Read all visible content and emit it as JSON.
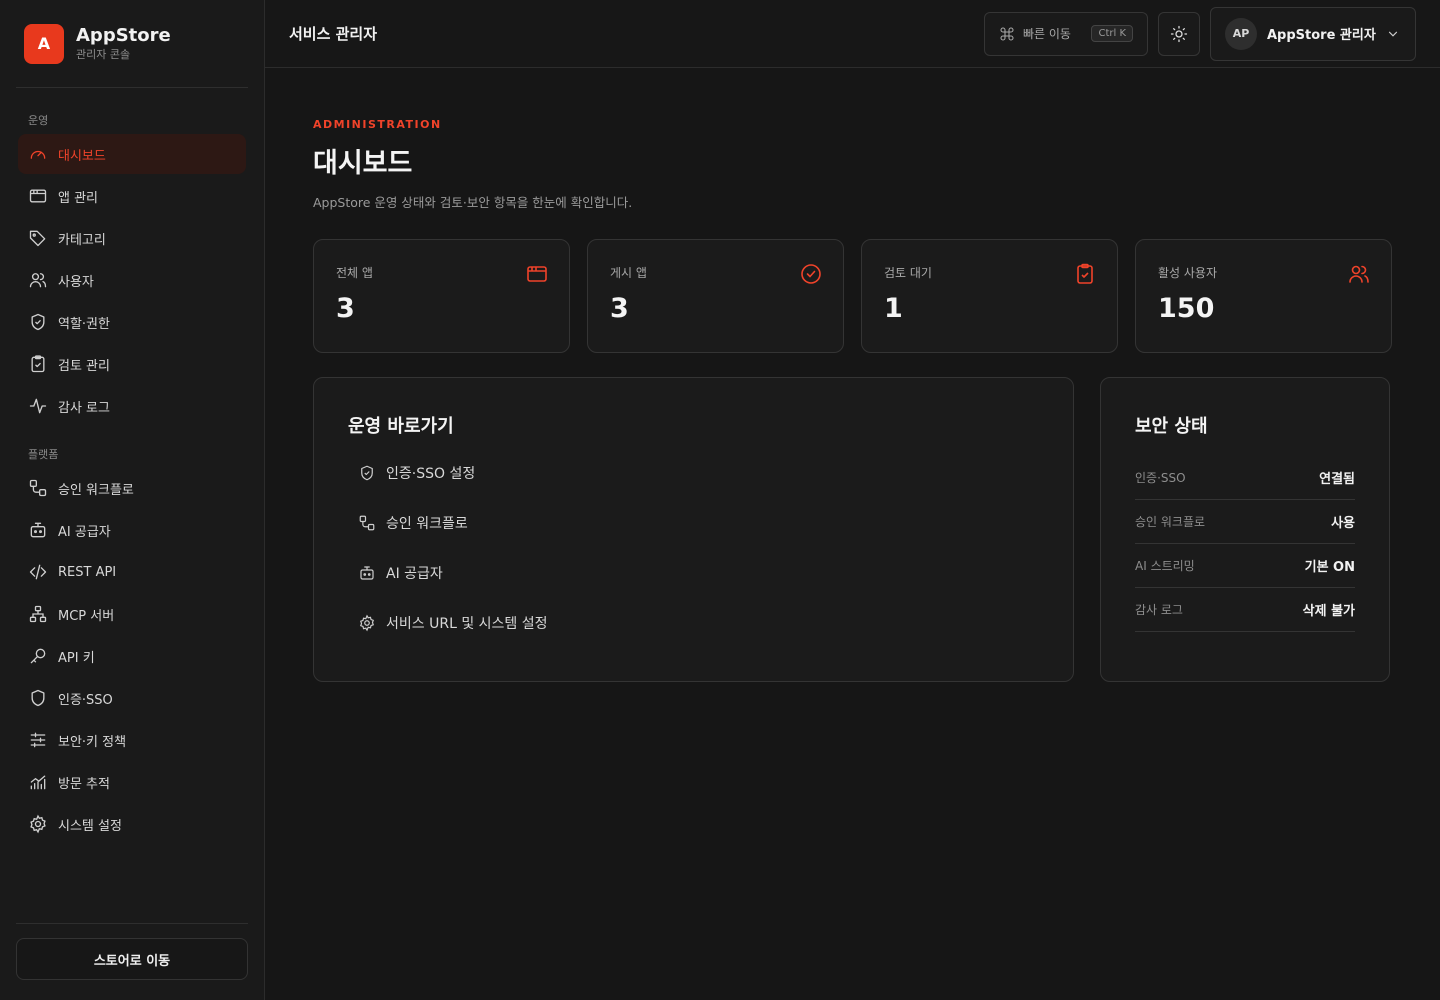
{
  "brand": {
    "logo_letter": "A",
    "name": "AppStore",
    "subtitle": "관리자 콘솔"
  },
  "sidebar": {
    "section_ops": "운영",
    "section_platform": "플랫폼",
    "ops_items": [
      {
        "label": "대시보드",
        "icon": "gauge-icon",
        "active": true
      },
      {
        "label": "앱 관리",
        "icon": "app-window-icon"
      },
      {
        "label": "카테고리",
        "icon": "tag-icon"
      },
      {
        "label": "사용자",
        "icon": "users-icon"
      },
      {
        "label": "역할·권한",
        "icon": "shield-check-icon"
      },
      {
        "label": "검토 관리",
        "icon": "clipboard-check-icon"
      },
      {
        "label": "감사 로그",
        "icon": "activity-icon"
      }
    ],
    "platform_items": [
      {
        "label": "승인 워크플로",
        "icon": "workflow-icon"
      },
      {
        "label": "AI 공급자",
        "icon": "bot-icon"
      },
      {
        "label": "REST API",
        "icon": "code-icon"
      },
      {
        "label": "MCP 서버",
        "icon": "network-icon"
      },
      {
        "label": "API 키",
        "icon": "key-icon"
      },
      {
        "label": "인증·SSO",
        "icon": "shield-icon"
      },
      {
        "label": "보안·키 정책",
        "icon": "sliders-icon"
      },
      {
        "label": "방문 추적",
        "icon": "chart-icon"
      },
      {
        "label": "시스템 설정",
        "icon": "gear-icon"
      }
    ],
    "store_button": "스토어로 이동"
  },
  "topbar": {
    "title": "서비스 관리자",
    "quick_nav": "빠른 이동",
    "shortcut": "Ctrl K",
    "avatar": "AP",
    "user_name": "AppStore 관리자"
  },
  "page": {
    "eyebrow": "ADMINISTRATION",
    "title": "대시보드",
    "description": "AppStore 운영 상태와 검토·보안 항목을 한눈에 확인합니다."
  },
  "stats": [
    {
      "label": "전체 앱",
      "value": "3",
      "icon": "app-window-icon"
    },
    {
      "label": "게시 앱",
      "value": "3",
      "icon": "check-circle-icon"
    },
    {
      "label": "검토 대기",
      "value": "1",
      "icon": "clipboard-check-icon"
    },
    {
      "label": "활성 사용자",
      "value": "150",
      "icon": "users-icon"
    }
  ],
  "quick_links": {
    "title": "운영 바로가기",
    "items": [
      {
        "label": "인증·SSO 설정",
        "icon": "shield-check-icon"
      },
      {
        "label": "승인 워크플로",
        "icon": "workflow-icon"
      },
      {
        "label": "AI 공급자",
        "icon": "bot-icon"
      },
      {
        "label": "서비스 URL 및 시스템 설정",
        "icon": "gear-icon"
      }
    ]
  },
  "security": {
    "title": "보안 상태",
    "rows": [
      {
        "label": "인증·SSO",
        "value": "연결됨"
      },
      {
        "label": "승인 워크플로",
        "value": "사용"
      },
      {
        "label": "AI 스트리밍",
        "value": "기본 ON"
      },
      {
        "label": "감사 로그",
        "value": "삭제 불가"
      }
    ]
  },
  "colors": {
    "accent": "#f0432a",
    "brand": "#e8391d",
    "background": "#161616"
  }
}
